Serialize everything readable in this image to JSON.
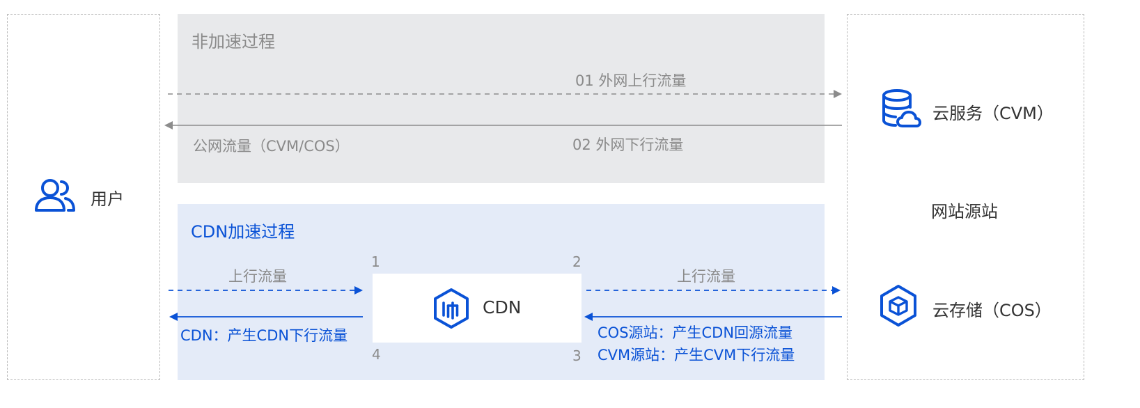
{
  "user": {
    "label": "用户",
    "icon": "users-icon"
  },
  "non_accel": {
    "title": "非加速过程",
    "upstream_label": "01 外网上行流量",
    "downstream_label": "02 外网下行流量",
    "public_traffic_label": "公网流量（CVM/COS）"
  },
  "cdn_accel": {
    "title": "CDN加速过程",
    "left_up_label": "上行流量",
    "right_up_label": "上行流量",
    "left_down_label": "CDN：产生CDN下行流量",
    "right_down_label_1": "COS源站：产生CDN回源流量",
    "right_down_label_2": "CVM源站：产生CVM下行流量",
    "node": {
      "label": "CDN",
      "icon": "cdn-icon"
    },
    "corners": {
      "tl": "1",
      "tr": "2",
      "br": "3",
      "bl": "4"
    }
  },
  "origin": {
    "title": "网站源站",
    "cvm": {
      "label": "云服务（CVM）",
      "icon": "database-cloud-icon"
    },
    "cos": {
      "label": "云存储（COS）",
      "icon": "cube-icon"
    }
  },
  "colors": {
    "blue": "#0a52d6",
    "gray_line": "#8c8c8c",
    "gray_panel": "#e8e9eb",
    "blue_panel": "#e4ebf8"
  }
}
